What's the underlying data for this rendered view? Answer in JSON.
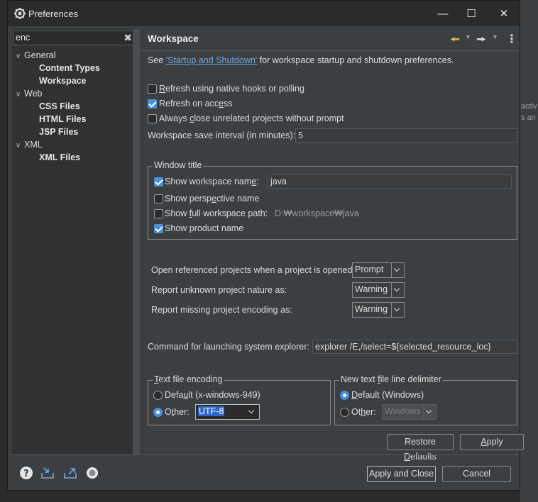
{
  "window": {
    "title": "Preferences"
  },
  "background_fragments": [
    "activ",
    "s an"
  ],
  "filter": {
    "value": "enc"
  },
  "tree": [
    {
      "label": "General",
      "level": 0
    },
    {
      "label": "Content Types",
      "level": 1
    },
    {
      "label": "Workspace",
      "level": 1
    },
    {
      "label": "Web",
      "level": 0
    },
    {
      "label": "CSS Files",
      "level": 1
    },
    {
      "label": "HTML Files",
      "level": 1
    },
    {
      "label": "JSP Files",
      "level": 1
    },
    {
      "label": "XML",
      "level": 0
    },
    {
      "label": "XML Files",
      "level": 1
    }
  ],
  "page": {
    "title": "Workspace",
    "intro_prefix": "See ",
    "intro_link": "'Startup and Shutdown'",
    "intro_suffix": " for workspace startup and shutdown preferences.",
    "refresh_native": {
      "label_pre": "",
      "label_u": "R",
      "label_post": "efresh using native hooks or polling",
      "checked": false
    },
    "refresh_access": {
      "label_pre": "Refresh on acc",
      "label_u": "e",
      "label_post": "ss",
      "checked": true
    },
    "always_close": {
      "label_pre": "Always ",
      "label_u": "c",
      "label_post": "lose unrelated projects without prompt",
      "checked": false
    },
    "save_interval": {
      "label": "Workspace save interval (in minutes):",
      "value": "5"
    },
    "window_title": {
      "group": "Window title",
      "show_ws_name": {
        "label_pre": "Show workspace nam",
        "label_u": "e",
        "label_post": ":",
        "checked": true,
        "value": "java"
      },
      "show_perspective": {
        "label_pre": "Show persp",
        "label_u": "e",
        "label_post": "ctive name",
        "checked": false
      },
      "show_full_path": {
        "label_pre": "Show ",
        "label_u": "f",
        "label_post": "ull workspace path:",
        "checked": false,
        "value": "D:₩workspace₩java"
      },
      "show_product": {
        "label": "Show product name",
        "checked": true
      }
    },
    "open_referenced": {
      "label": "Open referenced projects when a project is opened:",
      "value": "Prompt"
    },
    "unknown_nature": {
      "label": "Report unknown project nature as:",
      "value": "Warning"
    },
    "missing_encoding": {
      "label": "Report missing project encoding as:",
      "value": "Warning"
    },
    "explorer_cmd": {
      "label": "Command for launching system explorer:",
      "value": "explorer /E,/select=${selected_resource_loc}"
    },
    "encoding": {
      "group_pre": "",
      "group_u": "T",
      "group_post": "ext file encoding",
      "default_pre": "Defa",
      "default_u": "u",
      "default_post": "lt (x-windows-949)",
      "other_pre": "O",
      "other_u": "t",
      "other_post": "her:",
      "other_value": "UTF-8",
      "selected": "other"
    },
    "line_delim": {
      "group_pre": "New text ",
      "group_u": "f",
      "group_post": "ile line delimiter",
      "default_pre": "",
      "default_u": "D",
      "default_post": "efault (Windows)",
      "other_pre": "Ot",
      "other_u": "h",
      "other_post": "er:",
      "other_value": "Windows",
      "selected": "default"
    },
    "restore_pre": "Restore ",
    "restore_u": "D",
    "restore_post": "efaults",
    "apply_pre": "",
    "apply_u": "A",
    "apply_post": "pply"
  },
  "footer": {
    "apply_close": "Apply and Close",
    "cancel": "Cancel"
  }
}
